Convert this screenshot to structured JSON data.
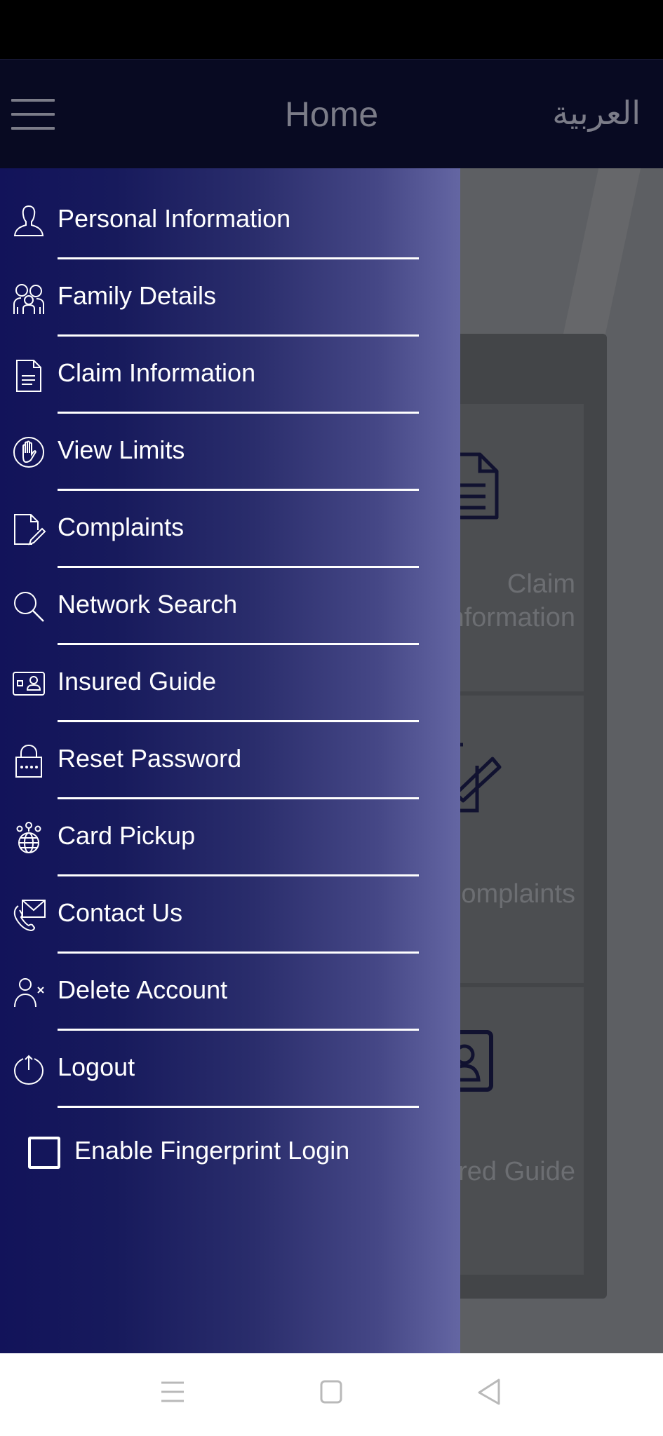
{
  "header": {
    "title": "Home",
    "language_toggle": "العربية",
    "menu_icon": "hamburger-icon"
  },
  "drawer": {
    "items": [
      {
        "label": "Personal Information",
        "icon": "user-icon"
      },
      {
        "label": "Family Details",
        "icon": "family-icon"
      },
      {
        "label": "Claim Information",
        "icon": "document-icon"
      },
      {
        "label": "View Limits",
        "icon": "hand-stop-icon"
      },
      {
        "label": "Complaints",
        "icon": "document-edit-icon"
      },
      {
        "label": "Network Search",
        "icon": "search-icon"
      },
      {
        "label": "Insured Guide",
        "icon": "id-card-icon"
      },
      {
        "label": "Reset Password",
        "icon": "lock-icon"
      },
      {
        "label": "Card Pickup",
        "icon": "globe-pin-icon"
      },
      {
        "label": "Contact Us",
        "icon": "phone-mail-icon"
      },
      {
        "label": "Delete Account",
        "icon": "user-remove-icon"
      },
      {
        "label": "Logout",
        "icon": "power-icon"
      }
    ],
    "fingerprint": {
      "label": "Enable Fingerprint Login",
      "checked": false
    }
  },
  "background": {
    "cards": [
      {
        "label_line1": "Claim",
        "label_line2": "Information"
      },
      {
        "label_line1": "Complaints",
        "label_line2": ""
      },
      {
        "label_line1": "Insured Guide",
        "label_line2": ""
      }
    ]
  },
  "system_nav": {
    "recents": "recents-icon",
    "home": "home-icon",
    "back": "back-icon"
  },
  "colors": {
    "header_bg": "#080a22",
    "drawer_gradient_start": "#12135a",
    "drawer_gradient_end": "#6466a3",
    "header_text": "#7b7c88",
    "overlay_bg": "#5d5f63"
  }
}
